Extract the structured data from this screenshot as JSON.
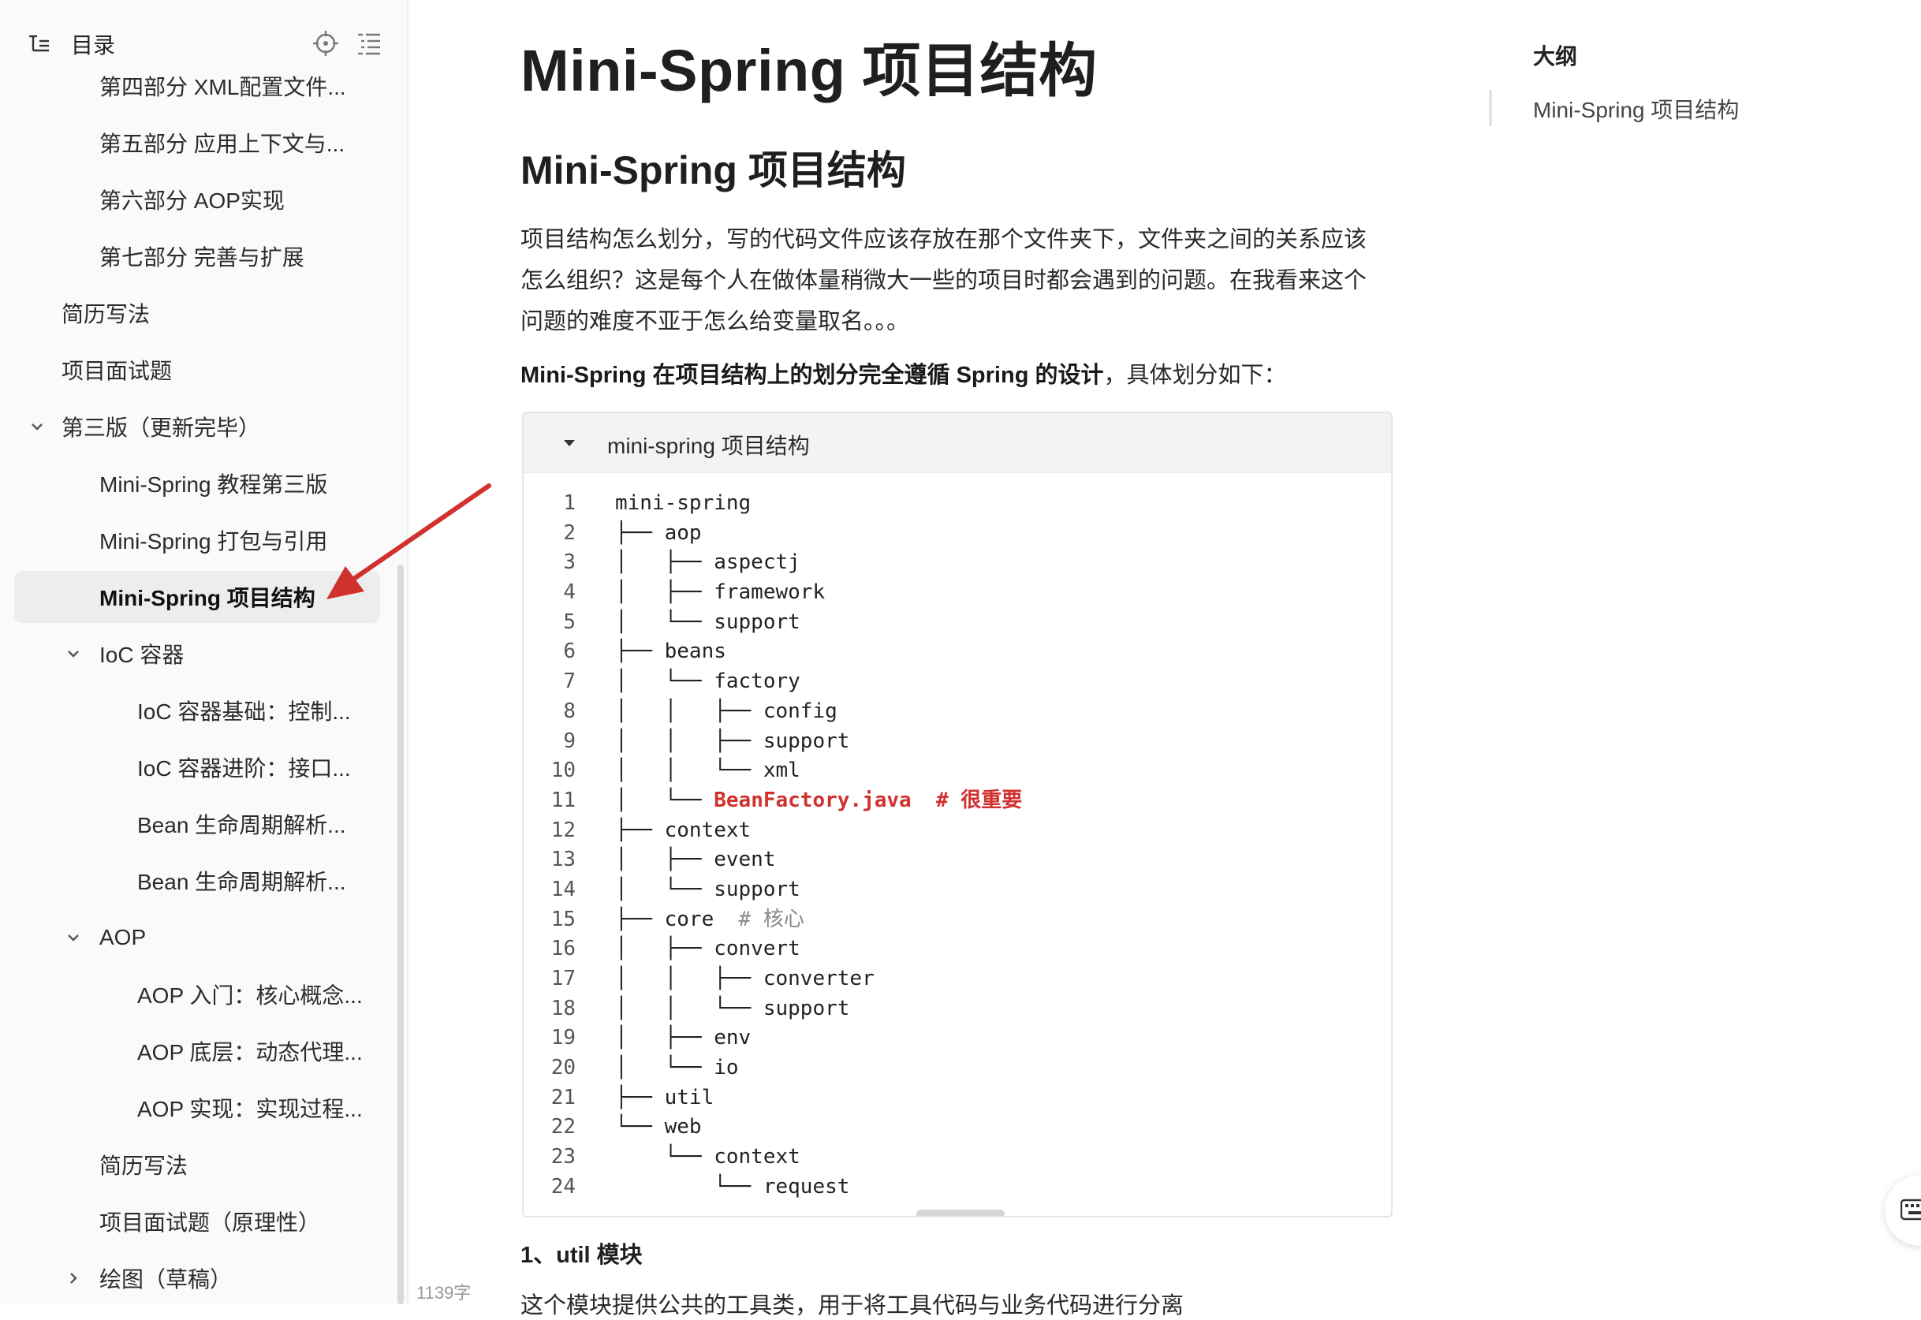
{
  "sidebar": {
    "title": "目录",
    "items": [
      {
        "label": "第四部分 XML配置文件..."
      },
      {
        "label": "第五部分 应用上下文与..."
      },
      {
        "label": "第六部分 AOP实现"
      },
      {
        "label": "第七部分 完善与扩展"
      },
      {
        "label": "简历写法"
      },
      {
        "label": "项目面试题"
      },
      {
        "label": "第三版（更新完毕）",
        "expanded": true
      },
      {
        "label": "Mini-Spring 教程第三版"
      },
      {
        "label": "Mini-Spring 打包与引用"
      },
      {
        "label": "Mini-Spring 项目结构",
        "active": true
      },
      {
        "label": "IoC 容器",
        "expanded": true
      },
      {
        "label": "IoC 容器基础：控制..."
      },
      {
        "label": "IoC 容器进阶：接口..."
      },
      {
        "label": "Bean 生命周期解析..."
      },
      {
        "label": "Bean 生命周期解析..."
      },
      {
        "label": "AOP",
        "expanded": true
      },
      {
        "label": "AOP 入门：核心概念..."
      },
      {
        "label": "AOP 底层：动态代理..."
      },
      {
        "label": "AOP 实现：实现过程..."
      },
      {
        "label": "简历写法"
      },
      {
        "label": "项目面试题（原理性）"
      },
      {
        "label": "绘图（草稿）",
        "expanded": false
      }
    ]
  },
  "word_count": "1139字",
  "article": {
    "h1": "Mini-Spring 项目结构",
    "h2": "Mini-Spring 项目结构",
    "paragraph": "项目结构怎么划分，写的代码文件应该存放在那个文件夹下，文件夹之间的关系应该怎么组织？这是每个人在做体量稍微大一些的项目时都会遇到的问题。在我看来这个问题的难度不亚于怎么给变量取名。。。",
    "intro_bold": "Mini-Spring 在项目结构上的划分完全遵循 Spring 的设计",
    "intro_rest": "，具体划分如下：",
    "code_block": {
      "title": "mini-spring 项目结构",
      "lines": [
        {
          "n": "1",
          "text": "mini-spring"
        },
        {
          "n": "2",
          "text": "├── aop"
        },
        {
          "n": "3",
          "text": "│   ├── aspectj"
        },
        {
          "n": "4",
          "text": "│   ├── framework"
        },
        {
          "n": "5",
          "text": "│   └── support"
        },
        {
          "n": "6",
          "text": "├── beans"
        },
        {
          "n": "7",
          "text": "│   └── factory"
        },
        {
          "n": "8",
          "text": "│   │   ├── config"
        },
        {
          "n": "9",
          "text": "│   │   ├── support"
        },
        {
          "n": "10",
          "text": "│   │   └── xml"
        },
        {
          "n": "11",
          "text": "│   └── ",
          "highlight": "BeanFactory.java  # 很重要"
        },
        {
          "n": "12",
          "text": "├── context"
        },
        {
          "n": "13",
          "text": "│   ├── event"
        },
        {
          "n": "14",
          "text": "│   └── support"
        },
        {
          "n": "15",
          "text": "├── core  ",
          "comment": "# 核心"
        },
        {
          "n": "16",
          "text": "│   ├── convert"
        },
        {
          "n": "17",
          "text": "│   │   ├── converter"
        },
        {
          "n": "18",
          "text": "│   │   └── support"
        },
        {
          "n": "19",
          "text": "│   ├── env"
        },
        {
          "n": "20",
          "text": "│   └── io"
        },
        {
          "n": "21",
          "text": "├── util"
        },
        {
          "n": "22",
          "text": "└── web"
        },
        {
          "n": "23",
          "text": "    └── context"
        },
        {
          "n": "24",
          "text": "        └── request"
        }
      ]
    },
    "h3": "1、util 模块",
    "paragraph3": "这个模块提供公共的工具类，用于将工具代码与业务代码进行分离"
  },
  "outline": {
    "title": "大纲",
    "items": [
      {
        "label": "Mini-Spring 项目结构"
      }
    ]
  },
  "colors": {
    "accent_red": "#d0312d",
    "active_bg": "#eceded"
  }
}
